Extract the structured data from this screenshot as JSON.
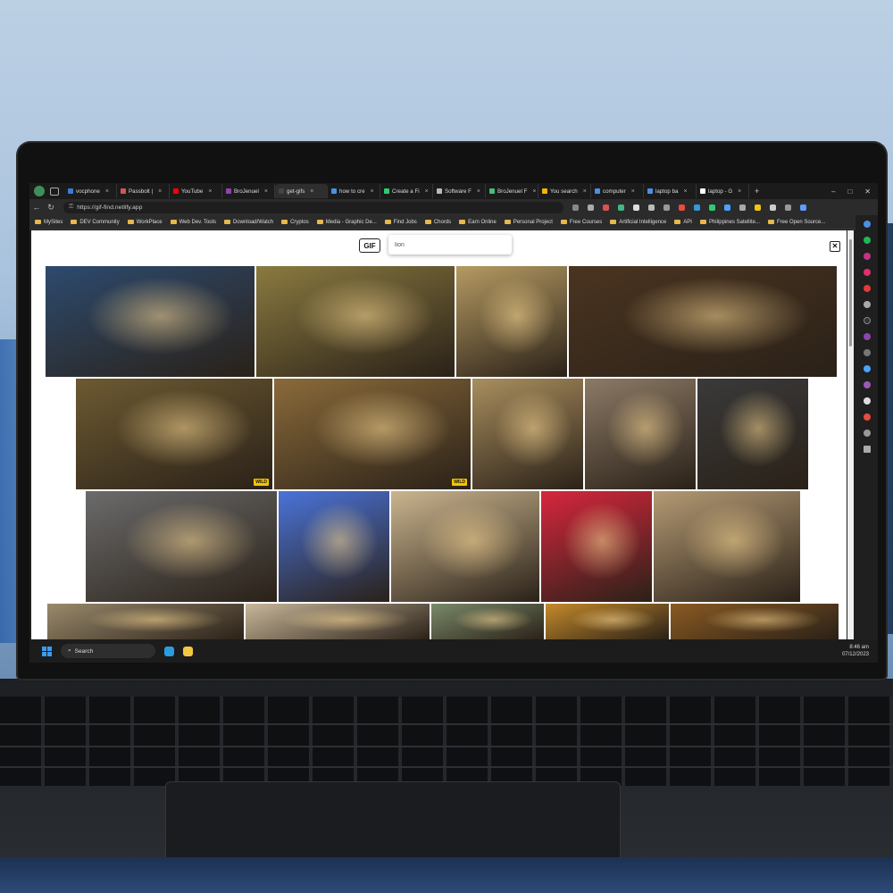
{
  "browser": {
    "tabs": [
      {
        "label": "vocphone",
        "color": "#3a7bd5"
      },
      {
        "label": "Passbolt |",
        "color": "#d9534f"
      },
      {
        "label": "YouTube",
        "color": "#ff0000"
      },
      {
        "label": "BroJenuel",
        "color": "#8e44ad"
      },
      {
        "label": "get-gifs",
        "color": "#444444",
        "active": true
      },
      {
        "label": "how to cre",
        "color": "#4a90e2"
      },
      {
        "label": "Create a Fi",
        "color": "#2ecc71"
      },
      {
        "label": "Software F",
        "color": "#bbbbbb"
      },
      {
        "label": "BroJenuel F",
        "color": "#3fbf7f"
      },
      {
        "label": "You search",
        "color": "#f4b400"
      },
      {
        "label": "computer",
        "color": "#4a90e2"
      },
      {
        "label": "laptop ba",
        "color": "#4a90e2"
      },
      {
        "label": "laptop - G",
        "color": "#ffffff"
      }
    ],
    "new_tab": "+",
    "url": "https://gif-find.netlify.app",
    "bookmarks": [
      "MySites",
      "DEV Community",
      "WorkPlace",
      "Web Dev. Tools",
      "Download/Watch",
      "Cryptos",
      "Media - Graphic De...",
      "Find Jobs",
      "Chords",
      "Earn Online",
      "Personal Project",
      "Free Courses",
      "Artificial Intelligence",
      "API",
      "Philippines Satellite...",
      "Free Open Source..."
    ]
  },
  "page": {
    "logo": "GIF",
    "search_value": "lion",
    "close_label": "✕",
    "gifs": [
      {
        "name": "lion-roar-dusk",
        "color": "#2d4a6e"
      },
      {
        "name": "lion-running-savanna",
        "color": "#8a7a40"
      },
      {
        "name": "lion-resting-plain",
        "color": "#b59a62"
      },
      {
        "name": "lion-roar-closeup",
        "color": "#4a3420"
      },
      {
        "name": "lion-walking-grass",
        "color": "#6d5a32",
        "badge": "WILD"
      },
      {
        "name": "lion-prowling-field",
        "color": "#8a6a3a",
        "badge": "WILD"
      },
      {
        "name": "lion-cubs-rock",
        "color": "#a98e5e"
      },
      {
        "name": "lion-in-tree",
        "color": "#8c7a66"
      },
      {
        "name": "lion-mascot-court",
        "color": "#3a3a3a"
      },
      {
        "name": "lion-bw-portrait",
        "color": "#6b6b6b"
      },
      {
        "name": "cartoon-lion-blue",
        "color": "#4a73d9"
      },
      {
        "name": "lion-cubs-playing",
        "color": "#cbb58f"
      },
      {
        "name": "cartoon-lion-red",
        "color": "#d7263d"
      },
      {
        "name": "lion-cub-cage",
        "color": "#b49a74"
      },
      {
        "name": "lion-cubs-people",
        "color": "#9a8a6c"
      },
      {
        "name": "lion-cub-window",
        "color": "#c9b79a"
      },
      {
        "name": "lion-cub-green",
        "color": "#7a8a6a"
      },
      {
        "name": "lion-crown",
        "color": "#c58a2a"
      },
      {
        "name": "lion-behind-bars",
        "color": "#8a5a22"
      }
    ]
  },
  "taskbar": {
    "search_label": "Search",
    "time": "8:46 am",
    "date": "07/12/2023"
  },
  "colors": {
    "accent": "#3b9cf0",
    "chrome_dark": "#1f1f1f"
  }
}
